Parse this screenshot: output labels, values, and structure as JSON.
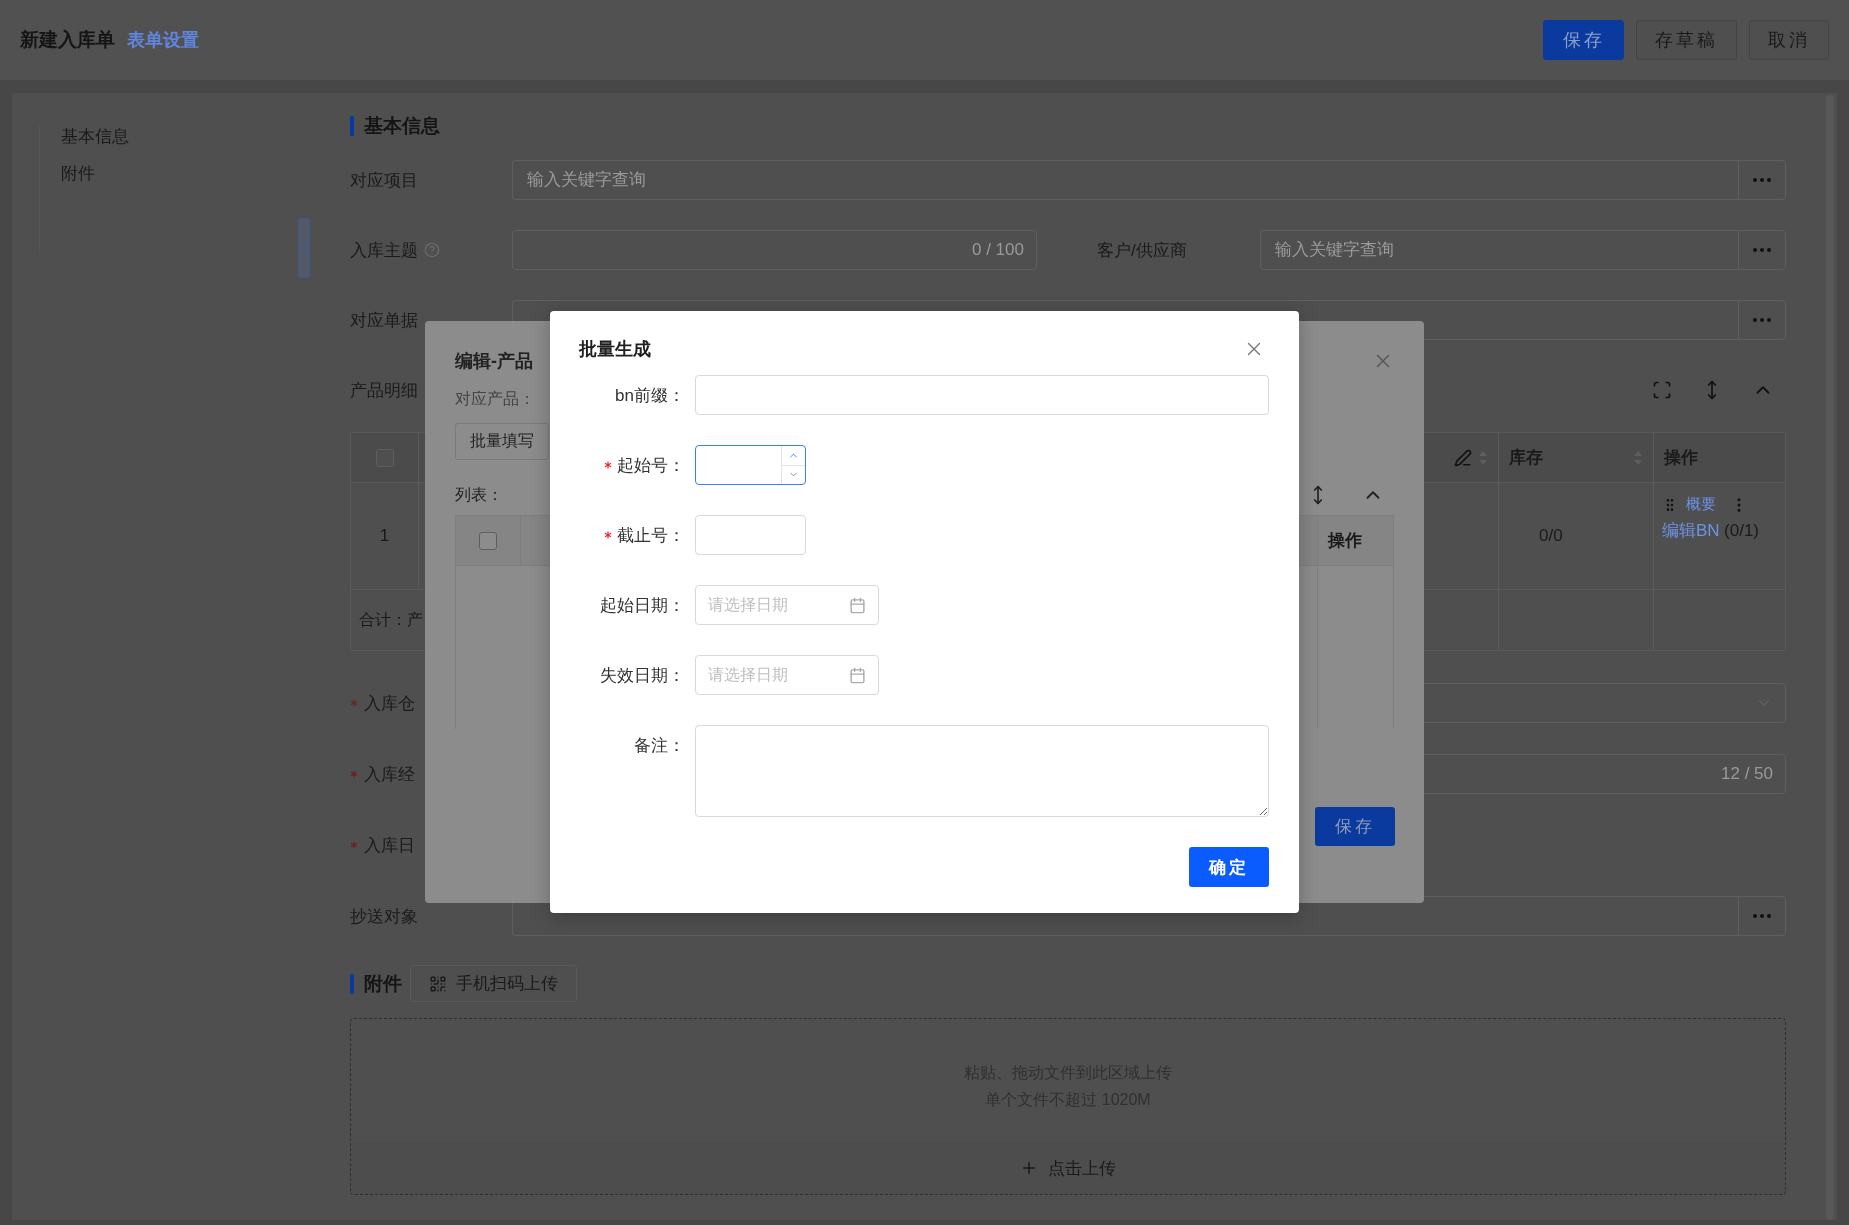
{
  "header": {
    "title": "新建入库单",
    "settings_link": "表单设置",
    "buttons": [
      {
        "label": "保存",
        "kind": "primary"
      },
      {
        "label": "存草稿",
        "kind": "default"
      },
      {
        "label": "取消",
        "kind": "default"
      }
    ]
  },
  "side_nav": {
    "items": [
      {
        "label": "基本信息"
      },
      {
        "label": "附件"
      }
    ]
  },
  "basic_info": {
    "title": "基本信息",
    "project": {
      "label": "对应项目",
      "placeholder": "输入关键字查询"
    },
    "subject": {
      "label": "入库主题",
      "counter": "0 / 100"
    },
    "customer": {
      "label": "客户/供应商",
      "placeholder": "输入关键字查询"
    },
    "document": {
      "label": "对应单据"
    }
  },
  "products": {
    "label": "产品明细",
    "header_checked": false,
    "columns": [
      {
        "kind": "edit"
      },
      {
        "kind": "sort",
        "label": "库存"
      },
      {
        "kind": "plain",
        "label": "操作"
      }
    ],
    "rows": [
      {
        "index": "1",
        "stock": "0/0",
        "summary_link": "概要",
        "edit_bn_link": "编辑BN",
        "edit_bn_count": "(0/1)"
      }
    ],
    "total_label": "合计：产"
  },
  "lower_fields": [
    {
      "kind": "select",
      "label": "入库仓",
      "required": true
    },
    {
      "kind": "text",
      "label": "入库经",
      "required": true,
      "counter": "12 / 50"
    },
    {
      "kind": "blank",
      "label": "入库日",
      "required": true
    },
    {
      "kind": "lookup",
      "label": "抄送对象",
      "required": false
    }
  ],
  "attachments": {
    "title": "附件",
    "scan_button": "手机扫码上传",
    "drop_hint": "粘贴、拖动文件到此区域上传",
    "size_hint": "单个文件不超过 1020M",
    "upload_button": "点击上传"
  },
  "edit_dialog": {
    "title": "编辑-产品",
    "product_label": "对应产品：",
    "batch_fill_button": "批量填写",
    "list_label": "列表：",
    "header_checked": false,
    "action_column": "操作",
    "save_button": "保存"
  },
  "batch_dialog": {
    "title": "批量生成",
    "fields": [
      {
        "kind": "text",
        "label": "bn前缀：",
        "required": false
      },
      {
        "kind": "number",
        "label": "起始号：",
        "required": true,
        "focused": true
      },
      {
        "kind": "short",
        "label": "截止号：",
        "required": true
      },
      {
        "kind": "date",
        "label": "起始日期：",
        "required": false,
        "placeholder": "请选择日期"
      },
      {
        "kind": "date",
        "label": "失效日期：",
        "required": false,
        "placeholder": "请选择日期"
      },
      {
        "kind": "textarea",
        "label": "备注：",
        "required": false
      }
    ],
    "confirm_button": "确定"
  }
}
